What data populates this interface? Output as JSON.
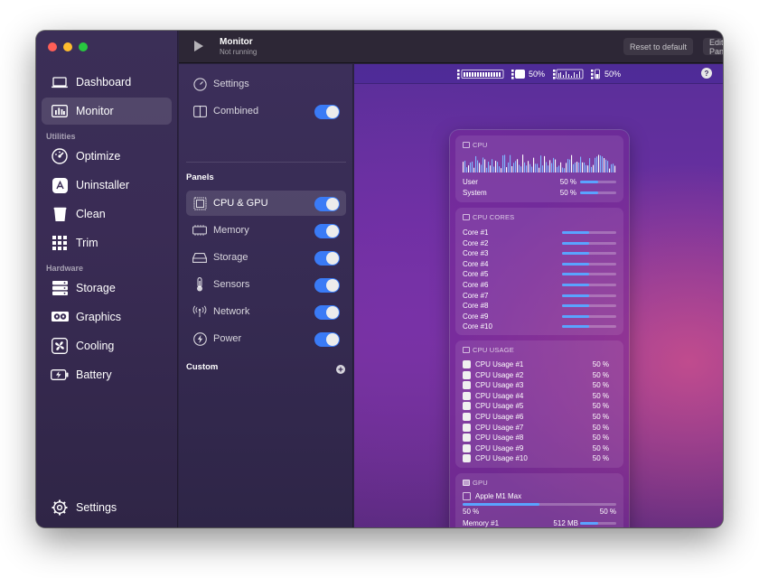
{
  "sidebar": {
    "items": [
      {
        "label": "Dashboard"
      },
      {
        "label": "Monitor"
      }
    ],
    "utilities_label": "Utilities",
    "utilities": [
      {
        "label": "Optimize"
      },
      {
        "label": "Uninstaller"
      },
      {
        "label": "Clean"
      },
      {
        "label": "Trim"
      }
    ],
    "hardware_label": "Hardware",
    "hardware": [
      {
        "label": "Storage"
      },
      {
        "label": "Graphics"
      },
      {
        "label": "Cooling"
      },
      {
        "label": "Battery"
      }
    ],
    "settings_label": "Settings"
  },
  "titlebar": {
    "title": "Monitor",
    "subtitle": "Not running",
    "reset_label": "Reset to default",
    "edit_label": "Edit Panel"
  },
  "panel": {
    "settings_label": "Settings",
    "combined_label": "Combined",
    "panels_heading": "Panels",
    "items": [
      {
        "label": "CPU & GPU"
      },
      {
        "label": "Memory"
      },
      {
        "label": "Storage"
      },
      {
        "label": "Sensors"
      },
      {
        "label": "Network"
      },
      {
        "label": "Power"
      }
    ],
    "custom_heading": "Custom"
  },
  "menubar": {
    "mem_pct": "50%",
    "gpu_pct": "50%"
  },
  "popover": {
    "cpu": {
      "title": "CPU",
      "user_label": "User",
      "user_value": "50 %",
      "system_label": "System",
      "system_value": "50 %",
      "usage_fraction": 0.5
    },
    "cores": {
      "title": "CPU CORES",
      "items": [
        "Core #1",
        "Core #2",
        "Core #3",
        "Core #4",
        "Core #5",
        "Core #6",
        "Core #7",
        "Core #8",
        "Core #9",
        "Core #10"
      ],
      "usage_fraction": 0.5
    },
    "usage": {
      "title": "CPU USAGE",
      "items": [
        {
          "label": "CPU Usage #1",
          "value": "50 %"
        },
        {
          "label": "CPU Usage #2",
          "value": "50 %"
        },
        {
          "label": "CPU Usage #3",
          "value": "50 %"
        },
        {
          "label": "CPU Usage #4",
          "value": "50 %"
        },
        {
          "label": "CPU Usage #5",
          "value": "50 %"
        },
        {
          "label": "CPU Usage #6",
          "value": "50 %"
        },
        {
          "label": "CPU Usage #7",
          "value": "50 %"
        },
        {
          "label": "CPU Usage #8",
          "value": "50 %"
        },
        {
          "label": "CPU Usage #9",
          "value": "50 %"
        },
        {
          "label": "CPU Usage #10",
          "value": "50 %"
        }
      ]
    },
    "gpu": {
      "title": "GPU",
      "name": "Apple M1 Max",
      "util_left": "50 %",
      "util_right": "50 %",
      "util_fraction": 0.5,
      "memory_label": "Memory #1",
      "memory_value": "512 MB",
      "memory_fraction": 0.5
    }
  },
  "colors": {
    "accent": "#3a7bf6",
    "bar": "#5aa3ff"
  }
}
